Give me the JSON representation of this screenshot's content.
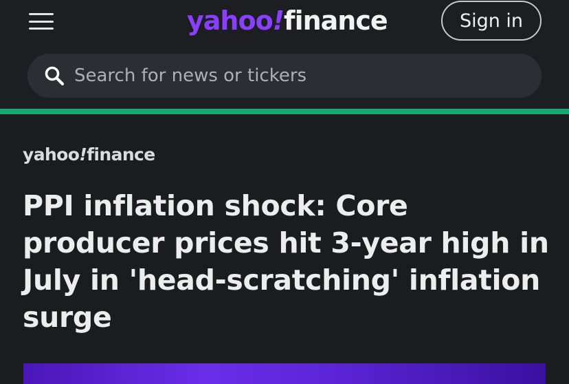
{
  "header": {
    "menu_icon": "hamburger-menu-icon",
    "logo": {
      "part1": "yahoo",
      "bang": "!",
      "part2": "finance"
    },
    "signin_label": "Sign in"
  },
  "search": {
    "icon": "search-icon",
    "placeholder": "Search for news or tickers"
  },
  "colors": {
    "accent": "#17a874",
    "brand_purple": "#8a3ffc",
    "background": "#1b1c20"
  },
  "article": {
    "source": {
      "part1": "yahoo",
      "bang": "!",
      "part2": "finance"
    },
    "headline": "PPI inflation shock: Core producer prices hit 3-year high in July in 'head-scratching' inflation surge"
  }
}
